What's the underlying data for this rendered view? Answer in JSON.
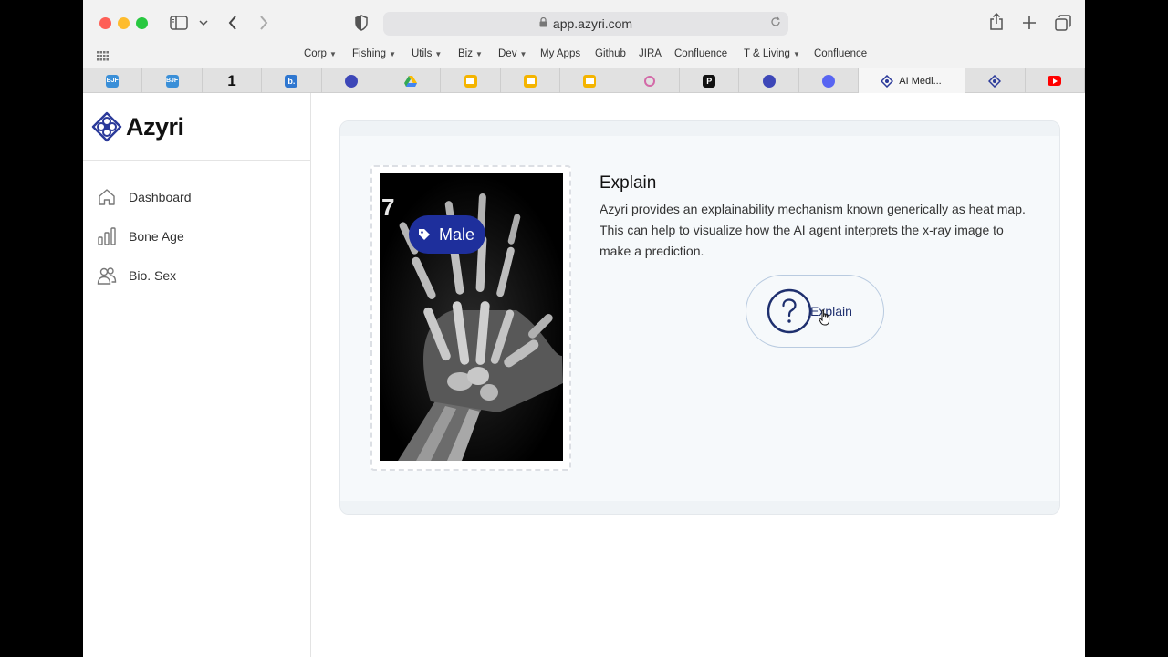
{
  "browser": {
    "url": "app.azyri.com",
    "bookmarks": [
      {
        "label": "Corp",
        "has_menu": true
      },
      {
        "label": "Fishing",
        "has_menu": true
      },
      {
        "label": "Utils",
        "has_menu": true
      },
      {
        "label": "Biz",
        "has_menu": true
      },
      {
        "label": "Dev",
        "has_menu": true
      },
      {
        "label": "My Apps",
        "has_menu": false
      },
      {
        "label": "Github",
        "has_menu": false
      },
      {
        "label": "JIRA",
        "has_menu": false
      },
      {
        "label": "Confluence",
        "has_menu": false
      },
      {
        "label": "T & Living",
        "has_menu": true
      },
      {
        "label": "Confluence",
        "has_menu": false
      }
    ],
    "tab_badges": {
      "bjf": "BJF",
      "one": "1",
      "b": "b."
    },
    "active_tab_title": "AI Medi..."
  },
  "sidebar": {
    "brand": "Azyri",
    "items": [
      {
        "label": "Dashboard",
        "icon": "home-icon"
      },
      {
        "label": "Bone Age",
        "icon": "bar-chart-icon"
      },
      {
        "label": "Bio. Sex",
        "icon": "users-icon"
      }
    ]
  },
  "main": {
    "prediction_label": "Male",
    "xray_marker": "7",
    "explain": {
      "title": "Explain",
      "description": "Azyri provides an explainability mechanism known generically as heat map. This can help to visualize how the AI agent interprets the x-ray image to make a prediction.",
      "button_label": "Explain"
    }
  },
  "colors": {
    "badge": "#1e2f9c",
    "logo": "#2b3a9a",
    "button_text": "#1e2f6e"
  }
}
